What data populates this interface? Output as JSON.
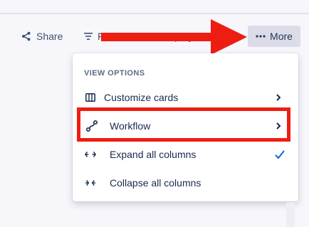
{
  "toolbar": {
    "share_label": "Share",
    "filter_label": "Filter",
    "group_label": "Group by Status",
    "more_label": "More"
  },
  "menu": {
    "section_title": "VIEW OPTIONS",
    "items": [
      {
        "label": "Customize cards",
        "icon": "columns-icon",
        "trailing": "chevron-right"
      },
      {
        "label": "Workflow",
        "icon": "workflow-icon",
        "trailing": "chevron-right"
      },
      {
        "label": "Expand all columns",
        "icon": "expand-arrows-icon",
        "trailing": "checkmark",
        "checked": true
      },
      {
        "label": "Collapse all columns",
        "icon": "collapse-arrows-icon",
        "trailing": "none"
      }
    ]
  },
  "annotations": {
    "arrow_color": "#ee1d12",
    "highlight_color": "#ee1d12"
  }
}
